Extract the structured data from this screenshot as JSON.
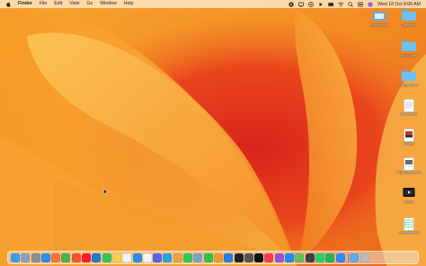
{
  "menubar": {
    "app_name": "Finder",
    "menus": [
      "File",
      "Edit",
      "View",
      "Go",
      "Window",
      "Help"
    ],
    "clock": "Wed 18 Oct  8:06 AM"
  },
  "desktop_items": [
    {
      "label": "Screenshots",
      "icon": "screenshot-folder-icon"
    },
    {
      "label": "Taphouse",
      "icon": "folder-icon"
    },
    {
      "label": "Study Desk",
      "icon": "folder-icon"
    },
    {
      "label": "Office Chairs",
      "icon": "folder-icon"
    },
    {
      "label": "Documents",
      "icon": "document-icon"
    },
    {
      "label": "Images",
      "icon": "image-file-icon"
    },
    {
      "label": "PDF Documents",
      "icon": "pdf-icon"
    },
    {
      "label": "Movies",
      "icon": "movie-icon"
    },
    {
      "label": "Spreadsheets",
      "icon": "spreadsheet-icon"
    }
  ],
  "dock": {
    "apps": [
      {
        "name": "finder-icon",
        "color": "#3b9cf0"
      },
      {
        "name": "launchpad-icon",
        "color": "#8ea0b8"
      },
      {
        "name": "system-settings-icon",
        "color": "#8e8e93"
      },
      {
        "name": "safari-icon",
        "color": "#2a8ff0"
      },
      {
        "name": "firefox-icon",
        "color": "#ff7139"
      },
      {
        "name": "chrome-icon",
        "color": "#4caf50"
      },
      {
        "name": "brave-icon",
        "color": "#fb542b"
      },
      {
        "name": "opera-icon",
        "color": "#ff1b2d"
      },
      {
        "name": "vscode-icon",
        "color": "#1f7ad2"
      },
      {
        "name": "messages-icon",
        "color": "#33c759"
      },
      {
        "name": "notes-icon",
        "color": "#f7cf46"
      },
      {
        "name": "reminders-icon",
        "color": "#f2f2f2"
      },
      {
        "name": "mail-icon",
        "color": "#2d8cf0"
      },
      {
        "name": "calendar-icon",
        "color": "#f4f4f4"
      },
      {
        "name": "discord-icon",
        "color": "#5865f2"
      },
      {
        "name": "telegram-icon",
        "color": "#2aa3e0"
      },
      {
        "name": "photos-icon",
        "color": "#e9a23b"
      },
      {
        "name": "facetime-icon",
        "color": "#35c759"
      },
      {
        "name": "preview-icon",
        "color": "#7aa4c9"
      },
      {
        "name": "numbers-icon",
        "color": "#2fbf4a"
      },
      {
        "name": "pages-icon",
        "color": "#f09a2a"
      },
      {
        "name": "keynote-icon",
        "color": "#2a7de1"
      },
      {
        "name": "terminal-icon",
        "color": "#222222"
      },
      {
        "name": "calculator-icon",
        "color": "#555555"
      },
      {
        "name": "apple-tv-icon",
        "color": "#111111"
      },
      {
        "name": "music-icon",
        "color": "#fa3c52"
      },
      {
        "name": "podcasts-icon",
        "color": "#9b4fe0"
      },
      {
        "name": "app-store-icon",
        "color": "#1a8cf7"
      },
      {
        "name": "maps-icon",
        "color": "#5ec25b"
      },
      {
        "name": "activity-monitor-icon",
        "color": "#3f3f3f"
      },
      {
        "name": "whatsapp-icon",
        "color": "#25d366"
      },
      {
        "name": "spotify-icon",
        "color": "#1db954"
      },
      {
        "name": "zoom-icon",
        "color": "#2d8cff"
      }
    ],
    "recents": [
      {
        "name": "downloads-folder-icon",
        "color": "#5aaeea"
      },
      {
        "name": "trash-icon",
        "color": "#b8bcc2"
      }
    ]
  }
}
